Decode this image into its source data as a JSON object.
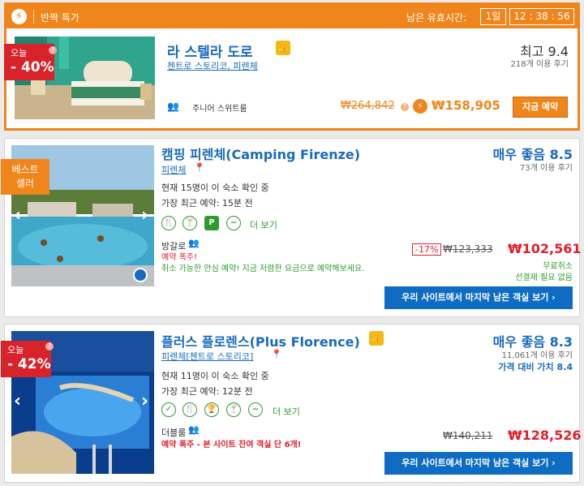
{
  "flash_deal": {
    "header_title": "반짝 특가",
    "remaining_label": "남은 유효시간:",
    "days": "1일",
    "time": "12 : 38 : 56",
    "badge_line1": "오늘",
    "badge_line2": "- 40%",
    "hotel_name": "라 스텔라 도로",
    "location": "첸트로 스토리코, 피렌체",
    "rating": "최고 9.4",
    "reviews": "218개 이용 후기",
    "room_type": "주니어 스위트룸",
    "old_price": "₩264,842",
    "price": "₩158,905",
    "book_button": "지금 예약"
  },
  "hotels": [
    {
      "badge_line1": "베스트",
      "badge_line2": "셀러",
      "name": "캠핑 피렌체(Camping Firenze)",
      "location": "피렌체",
      "rating": "매우 좋음 8.5",
      "reviews": "73개 이용 후기",
      "viewing": "현재 15명이 이 숙소 확인 중",
      "last_booked": "가장 최근 예약: 15분 전",
      "more": "더 보기",
      "room": "방갈로",
      "urgency": "예약 폭주!",
      "cancel_note": "취소 가능한 안심 예약! 지금 저렴한 요금으로 예약해보세요.",
      "discount": "-17%",
      "old_price": "₩123,333",
      "price": "₩102,561",
      "perk1": "무료취소",
      "perk2": "선결제 필요 없음",
      "cta": "우리 사이트에서 마지막 남은 객실 보기"
    },
    {
      "badge_line1": "오늘",
      "badge_line2": "- 42%",
      "name": "플러스 플로렌스(Plus Florence)",
      "location": "피렌체[첸트로 스토리코]",
      "rating": "매우 좋음 8.3",
      "reviews": "11,061개 이용 후기",
      "value": "가격 대비 가치 8.4",
      "viewing": "현재 11명이 이 숙소 확인 중",
      "last_booked": "가장 최근 예약: 12분 전",
      "more": "더 보기",
      "room": "더블룸",
      "urgency": "예약 폭주 - 본 사이트 잔여 객실 단 6개!",
      "old_price": "₩140,211",
      "price": "₩128,526",
      "cta": "우리 사이트에서 마지막 남은 객실 보기"
    }
  ],
  "colors": {
    "accent_orange": "#f0861b",
    "link_blue": "#1b6bbd",
    "price_red": "#e0202a",
    "amenity_green": "#2f9a2f"
  }
}
